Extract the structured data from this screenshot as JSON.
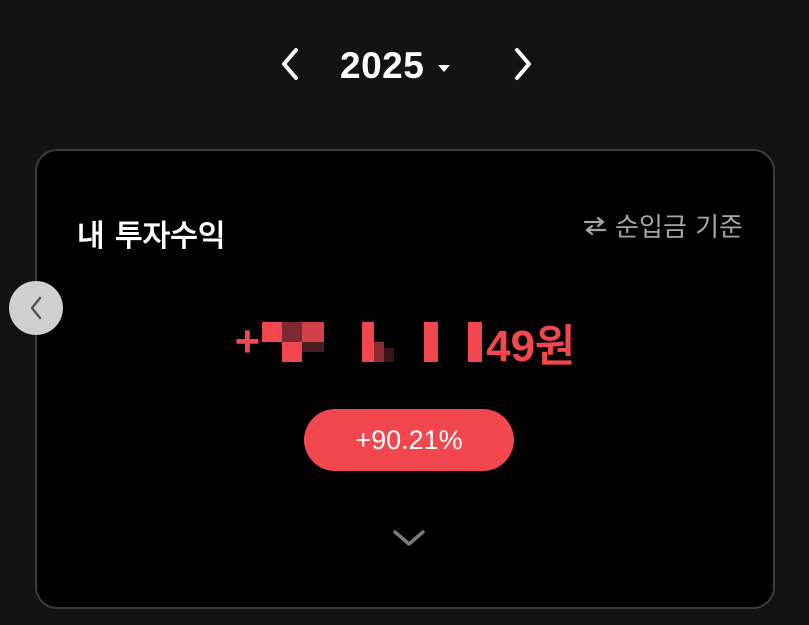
{
  "year_nav": {
    "year": "2025",
    "prev_icon": "chevron-left-icon",
    "next_icon": "chevron-right-icon",
    "dropdown_icon": "caret-down-icon"
  },
  "card": {
    "title": "내 투자수익",
    "basis_toggle": {
      "icon": "swap-arrows-icon",
      "label": "순입금 기준"
    },
    "profit": {
      "prefix": "+",
      "suffix": "49원",
      "redacted_icon": "pixelated-redaction"
    },
    "rate": "+90.21%",
    "expand_icon": "chevron-down-icon"
  },
  "carousel": {
    "prev_icon": "chevron-left-icon"
  },
  "colors": {
    "background": "#131313",
    "card_background": "#000000",
    "card_border": "#3c3c3c",
    "accent_red": "#f2474e",
    "muted_text": "#a6a6a6"
  }
}
